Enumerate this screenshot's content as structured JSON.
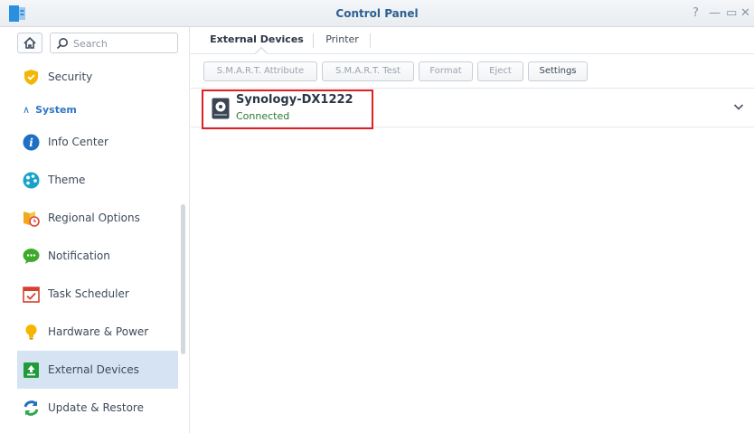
{
  "window": {
    "title": "Control Panel",
    "controls": {
      "help": "?",
      "minimize": "—",
      "maximize": "▭",
      "close": "✕"
    }
  },
  "sidebar": {
    "search_placeholder": "Search",
    "security_label": "Security",
    "section_label": "System",
    "items": [
      {
        "label": "Info Center",
        "icon": "info-icon"
      },
      {
        "label": "Theme",
        "icon": "palette-icon"
      },
      {
        "label": "Regional Options",
        "icon": "regional-clock-icon"
      },
      {
        "label": "Notification",
        "icon": "chat-bubble-icon"
      },
      {
        "label": "Task Scheduler",
        "icon": "calendar-check-icon"
      },
      {
        "label": "Hardware & Power",
        "icon": "lightbulb-icon"
      },
      {
        "label": "External Devices",
        "icon": "external-device-icon",
        "active": true
      },
      {
        "label": "Update & Restore",
        "icon": "refresh-icon"
      }
    ]
  },
  "tabs": [
    {
      "label": "External Devices",
      "active": true
    },
    {
      "label": "Printer",
      "active": false
    }
  ],
  "toolbar": {
    "smart_attribute": "S.M.A.R.T. Attribute",
    "smart_test": "S.M.A.R.T. Test",
    "format": "Format",
    "eject": "Eject",
    "settings": "Settings"
  },
  "device": {
    "name": "Synology-DX1222",
    "status": "Connected"
  },
  "colors": {
    "accent": "#2f76c4",
    "active_bg": "#d5e3f3",
    "highlight": "#e02020",
    "status_ok": "#2a7a2e"
  }
}
